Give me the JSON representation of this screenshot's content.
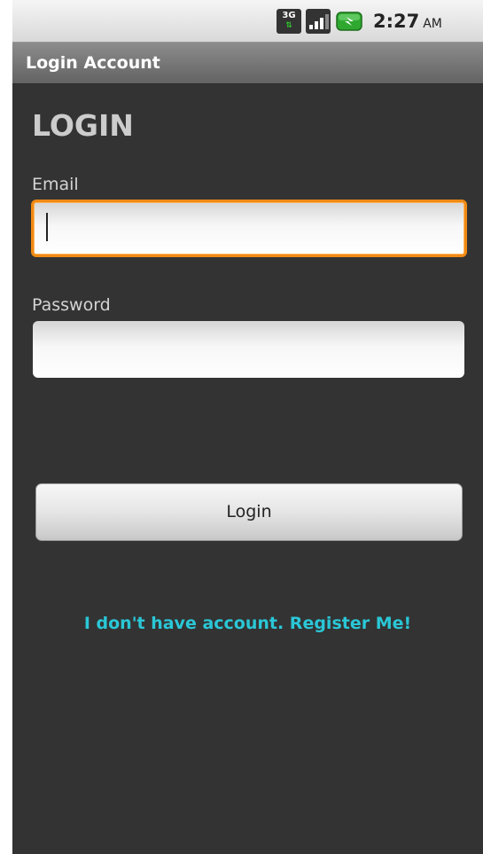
{
  "status_bar": {
    "network_type": "3G",
    "time": "2:27",
    "ampm": "AM",
    "battery_color": "#2fa82f"
  },
  "title_bar": {
    "title": "Login Account"
  },
  "form": {
    "heading": "LOGIN",
    "email": {
      "label": "Email",
      "value": "",
      "placeholder": ""
    },
    "password": {
      "label": "Password",
      "value": "",
      "placeholder": ""
    },
    "login_button_label": "Login",
    "register_link_text": "I don't have account. Register Me!"
  },
  "colors": {
    "background": "#333333",
    "focus_border": "#f08a14",
    "link": "#2ac7d6"
  },
  "icons": [
    "3g-icon",
    "signal-icon",
    "battery-icon"
  ]
}
